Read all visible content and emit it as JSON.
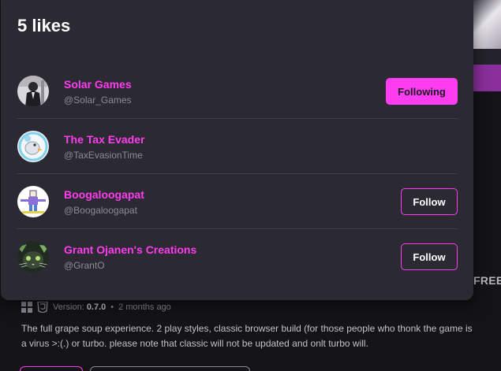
{
  "modal": {
    "title": "5 likes",
    "users": [
      {
        "name": "Solar Games",
        "handle": "@Solar_Games",
        "button": "Following",
        "avatar_icon": "suit-figure-avatar"
      },
      {
        "name": "The Tax Evader",
        "handle": "@TaxEvasionTime",
        "button": "",
        "avatar_icon": "cartoon-bird-avatar"
      },
      {
        "name": "Boogaloogapat",
        "handle": "@Boogaloogapat",
        "button": "Follow",
        "avatar_icon": "pixel-character-avatar"
      },
      {
        "name": "Grant Ojanen's Creations",
        "handle": "@GrantO",
        "button": "Follow",
        "avatar_icon": "green-cat-avatar"
      }
    ]
  },
  "background": {
    "price_label": "FREE",
    "version_label": "Version:",
    "version_value": "0.7.0",
    "dot": "•",
    "time_ago": "2 months ago",
    "description_line1": "The full grape soup experience. 2 play styles, classic browser build (for those people who thonk the game is",
    "description_line2": "a virus >:(.) or turbo. please note that classic will not be updated and onlt turbo will.",
    "platform_icons": [
      "windows-icon",
      "html5-icon"
    ]
  },
  "colors": {
    "accent": "#ff3df0",
    "modal_bg": "#2b2932",
    "page_bg": "#141317"
  }
}
